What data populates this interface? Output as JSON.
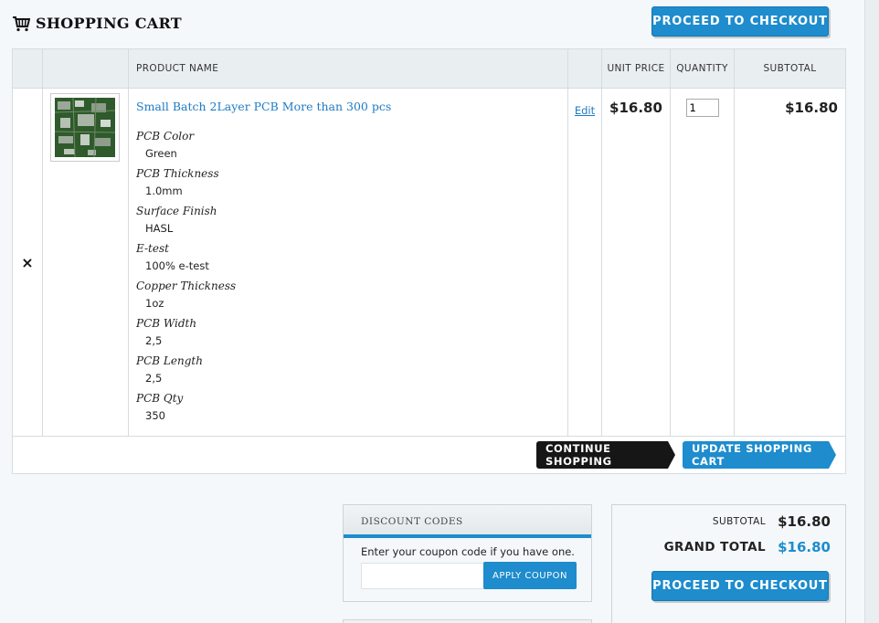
{
  "header": {
    "title": "SHOPPING CART",
    "checkout_label": "PROCEED TO CHECKOUT"
  },
  "table": {
    "columns": {
      "product_name": "PRODUCT NAME",
      "unit_price": "UNIT PRICE",
      "quantity": "QUANTITY",
      "subtotal": "SUBTOTAL"
    },
    "item": {
      "remove_symbol": "×",
      "name": "Small Batch 2Layer PCB More than 300 pcs",
      "edit_label": "Edit",
      "unit_price": "$16.80",
      "quantity": "1",
      "subtotal": "$16.80",
      "options": [
        {
          "label": "PCB Color",
          "value": "Green"
        },
        {
          "label": "PCB Thickness",
          "value": "1.0mm"
        },
        {
          "label": "Surface Finish",
          "value": "HASL"
        },
        {
          "label": "E-test",
          "value": "100% e-test"
        },
        {
          "label": "Copper Thickness",
          "value": "1oz"
        },
        {
          "label": "PCB Width",
          "value": "2,5"
        },
        {
          "label": "PCB Length",
          "value": "2,5"
        },
        {
          "label": "PCB Qty",
          "value": "350"
        }
      ]
    },
    "actions": {
      "continue_label": "CONTINUE SHOPPING",
      "update_label": "UPDATE SHOPPING CART"
    }
  },
  "discount": {
    "title": "DISCOUNT CODES",
    "prompt": "Enter your coupon code if you have one.",
    "apply_label": "APPLY COUPON",
    "code_value": ""
  },
  "totals": {
    "subtotal_label": "SUBTOTAL",
    "subtotal_value": "$16.80",
    "grand_label": "GRAND TOTAL",
    "grand_value": "$16.80",
    "checkout_label": "PROCEED TO CHECKOUT"
  },
  "colors": {
    "accent": "#1e8ccd",
    "dark_button": "#161616",
    "background": "#f4f8fa"
  },
  "icons": {
    "title_icon": "shopping-cart-icon",
    "remove_icon": "close-icon"
  }
}
